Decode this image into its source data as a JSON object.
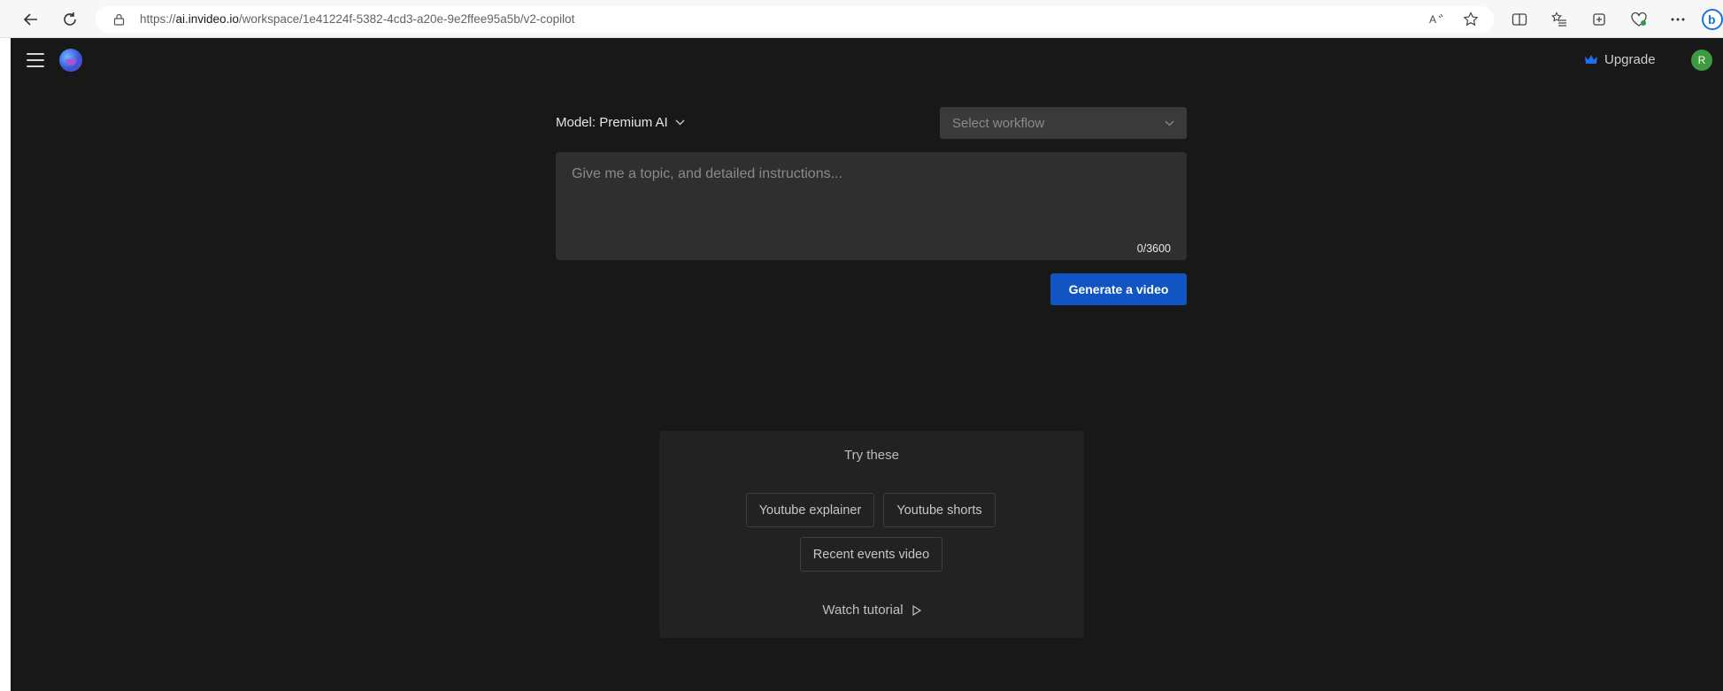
{
  "browser": {
    "url_prefix": "https://",
    "url_host": "ai.invideo.io",
    "url_path": "/workspace/1e41224f-5382-4cd3-a20e-9e2ffee95a5b/v2-copilot",
    "icons": [
      "back-icon",
      "refresh-icon",
      "lock-icon",
      "read-aloud-icon",
      "favorite-star-icon",
      "split-screen-icon",
      "favorites-list-icon",
      "collections-icon",
      "browser-essentials-icon",
      "more-icon",
      "bing-copilot-icon"
    ]
  },
  "header": {
    "upgrade_label": "Upgrade",
    "avatar_initial": "R"
  },
  "toolbar": {
    "model_label": "Model: Premium AI",
    "workflow_placeholder": "Select workflow"
  },
  "prompt": {
    "placeholder": "Give me a topic, and detailed instructions...",
    "counter": "0/3600"
  },
  "actions": {
    "generate_label": "Generate a video"
  },
  "suggestions": {
    "title": "Try these",
    "chips": [
      "Youtube explainer",
      "Youtube shorts",
      "Recent events video"
    ],
    "tutorial_label": "Watch tutorial"
  },
  "colors": {
    "app_background": "#181818",
    "primary_button": "#1155c4",
    "input_background": "#2f2f2f",
    "avatar": "#3e9a3e"
  }
}
